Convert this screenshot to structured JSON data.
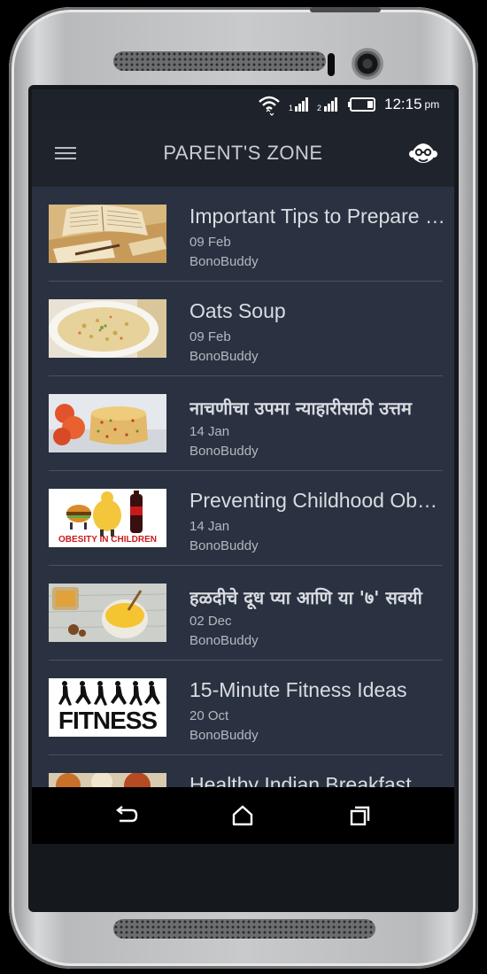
{
  "status_bar": {
    "time": "12:15",
    "ampm": "pm",
    "icons": [
      "wifi-icon",
      "signal-icon",
      "signal-icon",
      "battery-icon"
    ]
  },
  "app_bar": {
    "title": "PARENT'S ZONE",
    "menu_icon": "hamburger-menu-icon",
    "profile_icon": "monkey-avatar-icon"
  },
  "articles": [
    {
      "title": "Important Tips to Prepare for Exams",
      "date": "09 Feb",
      "author": "BonoBuddy",
      "image": "books-thumbnail"
    },
    {
      "title": "Oats Soup",
      "date": "09 Feb",
      "author": "BonoBuddy",
      "image": "soup-thumbnail"
    },
    {
      "title": "नाचणीचा उपमा न्याहारीसाठी उत्तम",
      "date": "14 Jan",
      "author": "BonoBuddy",
      "image": "upma-thumbnail"
    },
    {
      "title": "Preventing Childhood Obesity",
      "date": "14 Jan",
      "author": "BonoBuddy",
      "image": "obesity-thumbnail",
      "image_caption": "OBESITY IN CHILDREN"
    },
    {
      "title": "हळदीचे दूध प्या आणि या '७' सवयी",
      "date": "02 Dec",
      "author": "BonoBuddy",
      "image": "turmeric-milk-thumbnail"
    },
    {
      "title": "15-Minute Fitness Ideas",
      "date": "20 Oct",
      "author": "BonoBuddy",
      "image": "fitness-thumbnail",
      "image_caption": "FITNESS"
    },
    {
      "title": "Healthy Indian Breakfast",
      "date": "",
      "author": "",
      "image": "breakfast-thumbnail"
    }
  ],
  "nav_bar": {
    "buttons": [
      "back-icon",
      "home-icon",
      "recent-apps-icon"
    ]
  }
}
